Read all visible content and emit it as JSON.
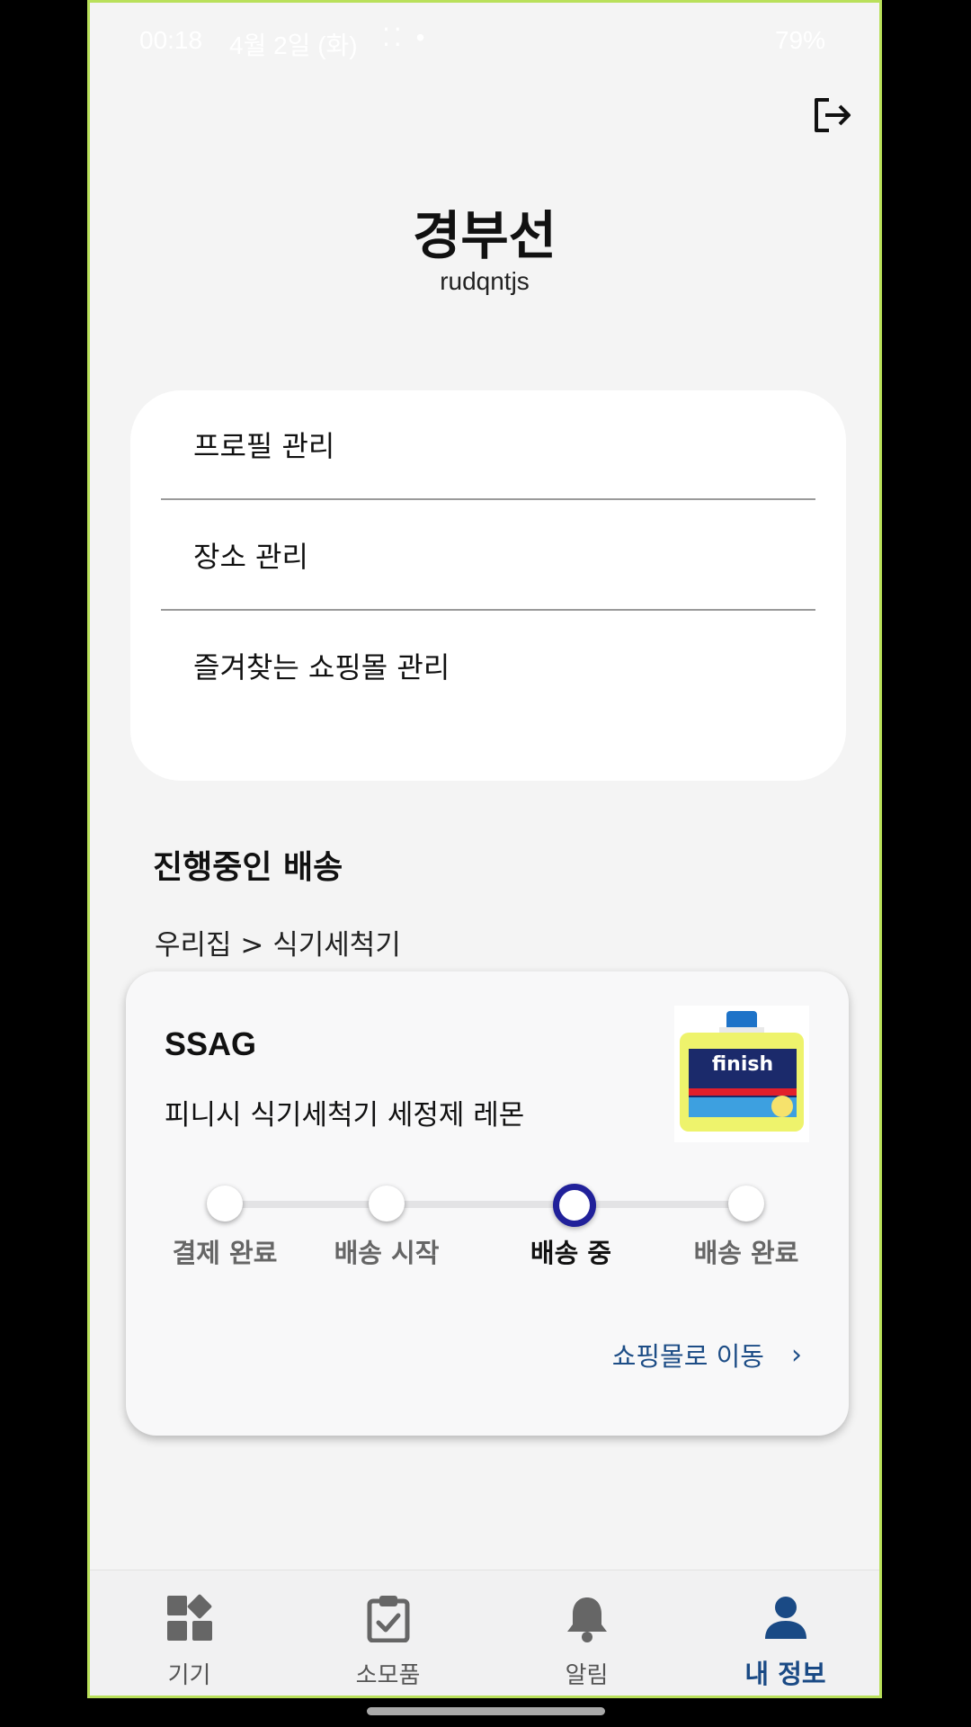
{
  "status_bar": {
    "time": "00:18",
    "date": "4월 2일 (화)",
    "battery": "79%"
  },
  "profile": {
    "name": "경부선",
    "user_id": "rudqntjs"
  },
  "menu": {
    "items": [
      {
        "label": "프로필 관리"
      },
      {
        "label": "장소 관리"
      },
      {
        "label": "즐겨찾는 쇼핑몰 관리"
      }
    ]
  },
  "delivery_section": {
    "title": "진행중인 배송",
    "location_path": "우리집 > 식기세척기",
    "card": {
      "shop": "SSAG",
      "product": "피니시 식기세척기 세정제 레몬",
      "steps": [
        {
          "label": "결제 완료",
          "active": false
        },
        {
          "label": "배송 시작",
          "active": false
        },
        {
          "label": "배송 중",
          "active": true
        },
        {
          "label": "배송 완료",
          "active": false
        }
      ],
      "link_label": "쇼핑몰로 이동"
    }
  },
  "bottom_nav": {
    "items": [
      {
        "label": "기기",
        "icon": "grid-icon",
        "active": false
      },
      {
        "label": "소모품",
        "icon": "clipboard-check-icon",
        "active": false
      },
      {
        "label": "알림",
        "icon": "bell-icon",
        "active": false
      },
      {
        "label": "내 정보",
        "icon": "person-icon",
        "active": true
      }
    ]
  },
  "colors": {
    "accent": "#1a4a85",
    "active_step": "#21219a",
    "frame": "#b9e05a"
  }
}
